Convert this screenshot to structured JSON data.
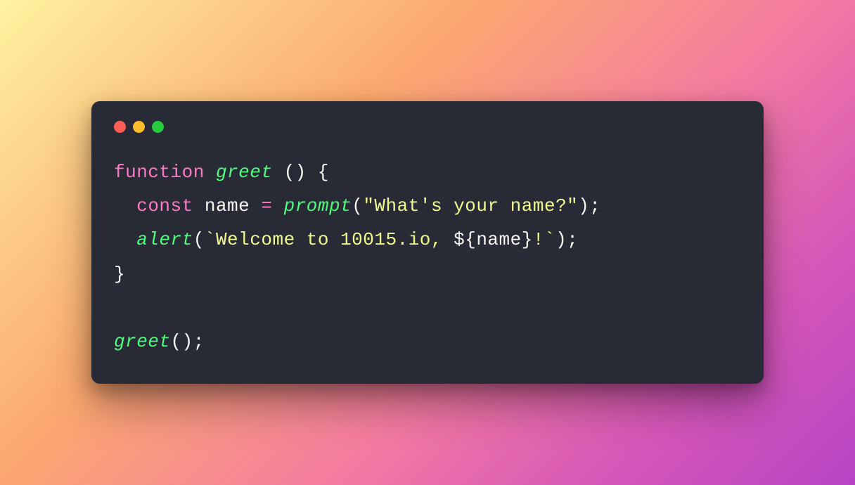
{
  "window": {
    "traffic_lights": [
      "red",
      "yellow",
      "green"
    ]
  },
  "code": {
    "line1": {
      "keyword": "function",
      "funcname": "greet",
      "parens": "()",
      "obrace": "{"
    },
    "line2": {
      "indent": "  ",
      "const": "const",
      "ident": "name",
      "eq": "=",
      "call": "prompt",
      "oparen": "(",
      "string": "\"What's your name?\"",
      "cparen": ")",
      "semi": ";"
    },
    "line3": {
      "indent": "  ",
      "call": "alert",
      "oparen": "(",
      "tick_open": "`",
      "tpl_text": "Welcome to 10015.io, ",
      "interp_open": "${",
      "interp_var": "name",
      "interp_close": "}",
      "tpl_text2": "!",
      "tick_close": "`",
      "cparen": ")",
      "semi": ";"
    },
    "line4": {
      "cbrace": "}"
    },
    "line6": {
      "call": "greet",
      "parens": "()",
      "semi": ";"
    }
  }
}
